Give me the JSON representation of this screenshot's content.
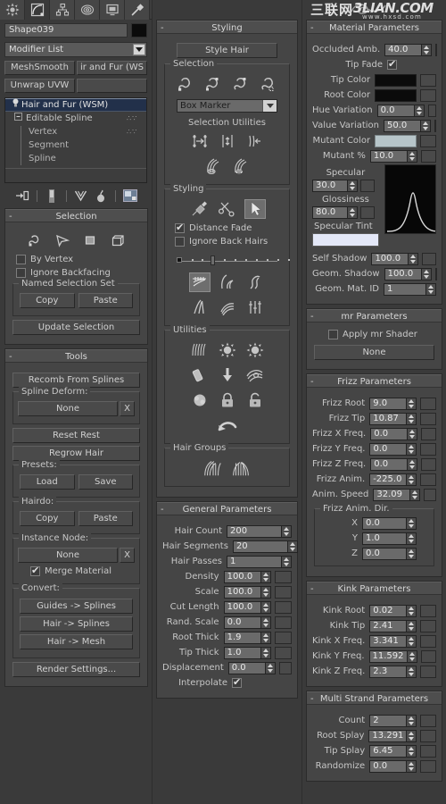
{
  "command_panel": {
    "tabs": [
      {
        "name": "create-tab",
        "icon": "star-icon",
        "active": false
      },
      {
        "name": "modify-tab",
        "icon": "curve-icon",
        "active": true
      },
      {
        "name": "hierarchy-tab",
        "icon": "hierarchy-icon",
        "active": false
      },
      {
        "name": "motion-tab",
        "icon": "motion-icon",
        "active": false
      },
      {
        "name": "display-tab",
        "icon": "display-icon",
        "active": false
      },
      {
        "name": "utilities-tab",
        "icon": "hammer-icon",
        "active": false
      }
    ],
    "object_name": "Shape039",
    "object_color": "#0b0b0b",
    "modifier_list_label": "Modifier List",
    "modifier_buttons": [
      "MeshSmooth",
      "ir and Fur (WS",
      "Unwrap UVW",
      ""
    ],
    "stack": [
      {
        "label": "Hair and Fur (WSM)",
        "indent": 0,
        "selected": true,
        "bulb": true,
        "dots": false
      },
      {
        "label": "Editable Spline",
        "indent": 1,
        "selected": false,
        "expand": true,
        "dots": true
      },
      {
        "label": "Vertex",
        "indent": 2,
        "selected": false,
        "dots": true
      },
      {
        "label": "Segment",
        "indent": 2,
        "selected": false,
        "dots": false
      },
      {
        "label": "Spline",
        "indent": 2,
        "selected": false,
        "dots": false
      }
    ],
    "stack_tools": [
      "pin-stack-icon",
      "show-end-result-icon",
      "make-unique-icon",
      "remove-modifier-icon",
      "configure-sets-icon"
    ]
  },
  "selection_rollout": {
    "title": "Selection",
    "mode_icons": [
      "guide-vertex-icon",
      "guide-icon",
      "guide-element-icon",
      "guide-box-icon"
    ],
    "by_vertex": {
      "label": "By Vertex",
      "checked": false
    },
    "ignore_backfacing": {
      "label": "Ignore Backfacing",
      "checked": false
    },
    "named_selection_set": {
      "label": "Named Selection Set",
      "copy": "Copy",
      "paste": "Paste"
    },
    "update_selection": "Update Selection"
  },
  "tools_rollout": {
    "title": "Tools",
    "recomb_from_splines": "Recomb From Splines",
    "spline_deform": {
      "label": "Spline Deform:",
      "value": "None",
      "clear": "X"
    },
    "reset_rest": "Reset Rest",
    "regrow_hair": "Regrow Hair",
    "presets": {
      "label": "Presets:",
      "load": "Load",
      "save": "Save"
    },
    "hairdo": {
      "label": "Hairdo:",
      "copy": "Copy",
      "paste": "Paste"
    },
    "instance_node": {
      "label": "Instance Node:",
      "value": "None",
      "clear": "X",
      "merge_material": {
        "label": "Merge Material",
        "checked": true
      }
    },
    "convert": {
      "label": "Convert:",
      "buttons": [
        "Guides -> Splines",
        "Hair -> Splines",
        "Hair -> Mesh"
      ]
    },
    "render_settings": "Render Settings..."
  },
  "styling_rollout": {
    "title": "Styling",
    "style_hair": "Style Hair",
    "selection_group": {
      "label": "Selection",
      "icons": [
        "select-hair-by-ends-icon",
        "select-whole-guide-icon",
        "select-guide-vertices-icon",
        "select-guide-by-region-icon"
      ],
      "marker_dropdown": "Box Marker",
      "utilities_label": "Selection Utilities",
      "utility_icons": [
        "invert-selection-icon",
        "rotate-selection-icon",
        "expand-selection-icon",
        "hide-selected-icon",
        "show-hidden-icon"
      ]
    },
    "styling_group": {
      "label": "Styling",
      "brush_icons": [
        "hairbrush-icon",
        "scissors-icon",
        "select-arrow-icon"
      ],
      "distance_fade": {
        "label": "Distance Fade",
        "checked": true
      },
      "ignore_back_hairs": {
        "label": "Ignore Back Hairs",
        "checked": false
      },
      "brush_size_slider": {
        "value": 25
      },
      "tool_icons": [
        "translate-hair-icon",
        "stand-hair-icon",
        "puff-roots-icon",
        "scale-hair-icon",
        "clump-hair-icon",
        "recomb-icon"
      ]
    },
    "utilities_group": {
      "label": "Utilities",
      "icons": [
        "hair-attenuate-icon",
        "pop-zero-sized-icon",
        "pop-selected-icon",
        "reset-rest-icon",
        "toggle-collisions-icon",
        "toggle-hair-icon",
        "lock-hair-icon",
        "unlock-hair-icon",
        "undo-icon"
      ]
    },
    "hair_groups": {
      "label": "Hair Groups",
      "icons": [
        "split-hair-group-icon",
        "merge-hair-group-icon"
      ]
    }
  },
  "general_parameters": {
    "title": "General Parameters",
    "fields": [
      {
        "label": "Hair Count",
        "value": "200",
        "map": false,
        "wide": true
      },
      {
        "label": "Hair Segments",
        "value": "20",
        "map": false,
        "wide": true
      },
      {
        "label": "Hair Passes",
        "value": "1",
        "map": false,
        "wide": true
      },
      {
        "label": "Density",
        "value": "100.0",
        "map": true
      },
      {
        "label": "Scale",
        "value": "100.0",
        "map": true
      },
      {
        "label": "Cut Length",
        "value": "100.0",
        "map": true
      },
      {
        "label": "Rand. Scale",
        "value": "0.0",
        "map": true
      },
      {
        "label": "Root Thick",
        "value": "1.9",
        "map": true
      },
      {
        "label": "Tip Thick",
        "value": "1.0",
        "map": true
      },
      {
        "label": "Displacement",
        "value": "0.0",
        "map": true
      }
    ],
    "interpolate": {
      "label": "Interpolate",
      "checked": true
    }
  },
  "material_parameters": {
    "title": "Material Parameters",
    "occluded_amb": {
      "label": "Occluded Amb.",
      "value": "40.0"
    },
    "tip_fade": {
      "label": "Tip Fade",
      "checked": true
    },
    "tip_color": {
      "label": "Tip Color",
      "color": "#141414"
    },
    "root_color": {
      "label": "Root Color",
      "color": "#181818"
    },
    "hue_variation": {
      "label": "Hue Variation",
      "value": "0.0"
    },
    "value_variation": {
      "label": "Value Variation",
      "value": "50.0"
    },
    "mutant_color": {
      "label": "Mutant Color",
      "color": "#b7c5c9"
    },
    "mutant_pct": {
      "label": "Mutant %",
      "value": "10.0"
    },
    "specular": {
      "label": "Specular",
      "value": "30.0"
    },
    "glossiness": {
      "label": "Glossiness",
      "value": "80.0"
    },
    "specular_tint": {
      "label": "Specular Tint",
      "color": "#e3e7f7"
    },
    "self_shadow": {
      "label": "Self Shadow",
      "value": "100.0"
    },
    "geom_shadow": {
      "label": "Geom. Shadow",
      "value": "100.0"
    },
    "geom_mat_id": {
      "label": "Geom. Mat. ID",
      "value": "1"
    }
  },
  "mr_parameters": {
    "title": "mr Parameters",
    "apply_mr_shader": {
      "label": "Apply mr Shader",
      "checked": false
    },
    "shader_slot": "None"
  },
  "frizz_parameters": {
    "title": "Frizz Parameters",
    "fields": [
      {
        "label": "Frizz Root",
        "value": "9.0"
      },
      {
        "label": "Frizz Tip",
        "value": "10.87"
      },
      {
        "label": "Frizz X Freq.",
        "value": "0.0"
      },
      {
        "label": "Frizz Y Freq.",
        "value": "0.0"
      },
      {
        "label": "Frizz Z Freq.",
        "value": "0.0"
      },
      {
        "label": "Frizz Anim.",
        "value": "-225.0"
      },
      {
        "label": "Anim. Speed",
        "value": "32.09"
      }
    ],
    "anim_dir": {
      "label": "Frizz Anim. Dir.",
      "axes": [
        {
          "label": "X",
          "value": "0.0"
        },
        {
          "label": "Y",
          "value": "1.0"
        },
        {
          "label": "Z",
          "value": "0.0"
        }
      ]
    }
  },
  "kink_parameters": {
    "title": "Kink Parameters",
    "fields": [
      {
        "label": "Kink Root",
        "value": "0.02"
      },
      {
        "label": "Kink Tip",
        "value": "2.41"
      },
      {
        "label": "Kink X Freq.",
        "value": "3.341"
      },
      {
        "label": "Kink Y Freq.",
        "value": "11.592"
      },
      {
        "label": "Kink Z Freq.",
        "value": "2.3"
      }
    ]
  },
  "multi_strand_parameters": {
    "title": "Multi Strand Parameters",
    "fields": [
      {
        "label": "Count",
        "value": "2"
      },
      {
        "label": "Root Splay",
        "value": "13.291"
      },
      {
        "label": "Tip Splay",
        "value": "6.45"
      },
      {
        "label": "Randomize",
        "value": "0.0"
      }
    ]
  },
  "watermark": {
    "cn": "三联网",
    "en": "3LIAN.COM",
    "sub": "www.hxsd.com"
  }
}
